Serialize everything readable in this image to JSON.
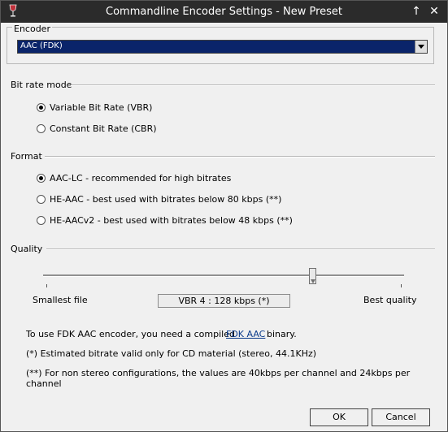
{
  "window": {
    "title": "Commandline Encoder Settings - New Preset"
  },
  "titlebar_buttons": {
    "up": "↑",
    "close": "✕"
  },
  "encoder": {
    "label": "Encoder",
    "selected": "AAC (FDK)"
  },
  "bitrate_mode": {
    "label": "Bit rate mode",
    "options": [
      {
        "label": "Variable Bit Rate (VBR)",
        "selected": true
      },
      {
        "label": "Constant Bit Rate (CBR)",
        "selected": false
      }
    ]
  },
  "format": {
    "label": "Format",
    "options": [
      {
        "label": "AAC-LC - recommended for high bitrates",
        "selected": true
      },
      {
        "label": "HE-AAC - best used with bitrates below 80 kbps (**)",
        "selected": false
      },
      {
        "label": "HE-AACv2 - best used with bitrates below 48 kbps (**)",
        "selected": false
      }
    ]
  },
  "quality": {
    "label": "Quality",
    "min_label": "Smallest file",
    "max_label": "Best quality",
    "value_text": "VBR 4 : 128 kbps (*)",
    "level_fraction": 0.75
  },
  "info": {
    "line1_prefix": "To use FDK AAC encoder, you need a compiled",
    "link_text": "FDK AAC",
    "line1_suffix": "binary.",
    "line2": "(*) Estimated bitrate valid only for CD material (stereo, 44.1KHz)",
    "line3": "(**) For non stereo configurations, the values are 40kbps per channel and 24kbps per channel"
  },
  "buttons": {
    "ok": "OK",
    "cancel": "Cancel"
  }
}
